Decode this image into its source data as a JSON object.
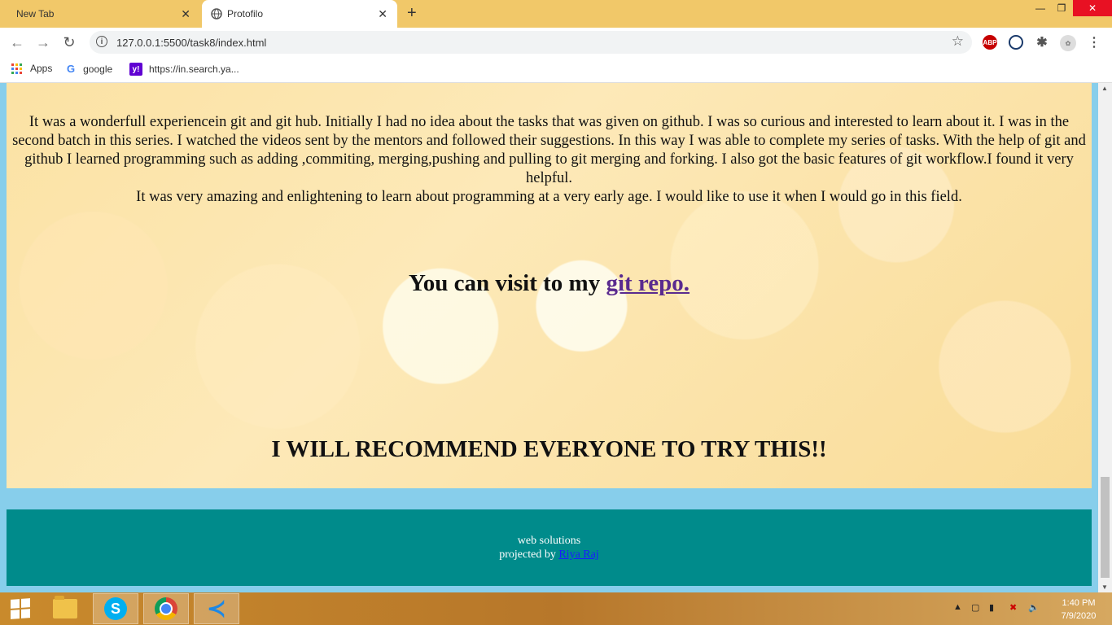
{
  "browser": {
    "tabs": [
      {
        "title": "New Tab",
        "active": false
      },
      {
        "title": "Protofilo",
        "active": true
      }
    ],
    "url": "127.0.0.1:5500/task8/index.html",
    "bookmarks": [
      {
        "label": "Apps",
        "icon": "apps-grid-icon"
      },
      {
        "label": "google",
        "icon": "google-icon"
      },
      {
        "label": "https://in.search.ya...",
        "icon": "yahoo-icon"
      }
    ],
    "extensions": {
      "abp": "ABP"
    }
  },
  "page": {
    "paragraph_lines": [
      "It was a wonderfull experiencein git and git hub. Initially I had no idea about the tasks that was given on github. I was so curious and interested to learn about it. I was in the second batch in this series. I watched the videos sent by the mentors and followed their suggestions. In this way I was able to complete my series of tasks. With the help of git and github I learned programming such as adding ,commiting, merging,pushing and pulling to git merging and forking. I also got the basic features of git workflow.I found it very helpful.",
      "It was very amazing and enlightening to learn about programming at a very early age. I would like to use it when I would go in this field."
    ],
    "visit_prefix": "You can visit to my ",
    "visit_link": "git repo.",
    "recommend": "I WILL RECOMMEND EVERYONE TO TRY THIS!!",
    "footer": {
      "line1": "web solutions",
      "line2_prefix": "projected by ",
      "author_link": "Riya Raj"
    }
  },
  "taskbar": {
    "apps": [
      "file-explorer",
      "skype",
      "chrome",
      "vscode"
    ],
    "time": "1:40 PM",
    "date": "7/9/2020"
  },
  "colors": {
    "tabstrip": "#f1c869",
    "page_bg": "#87ceeb",
    "footer_bg": "#008b8b",
    "link_visited": "#5a2a8f",
    "link": "#1a1aff"
  }
}
